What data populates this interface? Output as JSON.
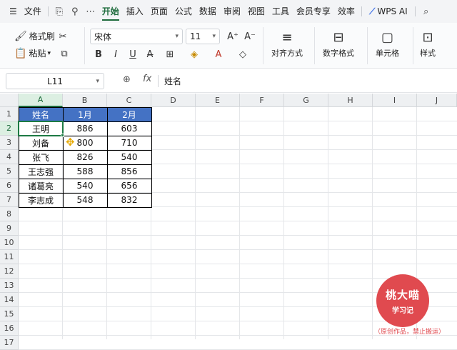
{
  "menubar": {
    "file": "文件",
    "tabs": [
      "开始",
      "插入",
      "页面",
      "公式",
      "数据",
      "审阅",
      "视图",
      "工具",
      "会员专享",
      "效率"
    ],
    "active_tab": "开始",
    "ai_label": "WPS AI"
  },
  "ribbon": {
    "format_painter": "格式刷",
    "paste": "粘贴",
    "font_name": "宋体",
    "font_size": "11",
    "align": "对齐方式",
    "number_format": "数字格式",
    "cell": "单元格",
    "style": "样式"
  },
  "formula_bar": {
    "name_box": "L11",
    "fx": "fx",
    "value": "姓名"
  },
  "grid": {
    "columns": [
      "A",
      "B",
      "C",
      "D",
      "E",
      "F",
      "G",
      "H",
      "I",
      "J"
    ],
    "rows": [
      "1",
      "2",
      "3",
      "4",
      "5",
      "6",
      "7",
      "8",
      "9",
      "10",
      "11",
      "12",
      "13",
      "14",
      "15",
      "16",
      "17"
    ],
    "selected_column": "A",
    "selected_row": "2"
  },
  "table": {
    "header": [
      "姓名",
      "1月",
      "2月"
    ],
    "rows": [
      [
        "王明",
        "886",
        "603"
      ],
      [
        "刘备",
        "800",
        "710"
      ],
      [
        "张飞",
        "826",
        "540"
      ],
      [
        "王志强",
        "588",
        "856"
      ],
      [
        "诸葛亮",
        "540",
        "656"
      ],
      [
        "李志成",
        "548",
        "832"
      ]
    ],
    "header_color": "#4472c4",
    "accent_color": "#1d7a44"
  },
  "watermark": {
    "line1": "桃大喵",
    "line2": "学习记",
    "note": "（原创作品，禁止搬运）",
    "color": "#e04a4f"
  }
}
